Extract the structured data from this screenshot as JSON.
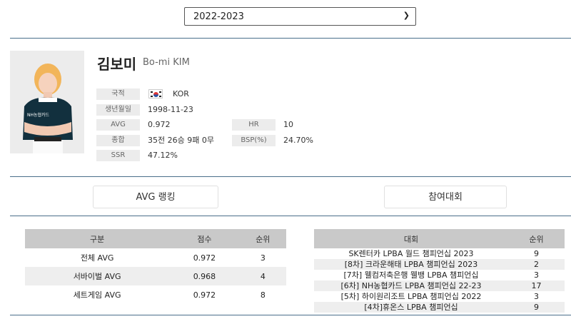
{
  "season": {
    "selected": "2022-2023"
  },
  "player": {
    "name_ko": "김보미",
    "name_en": "Bo-mi KIM",
    "info": {
      "nationality_label": "국적",
      "nationality": "KOR",
      "birth_label": "생년월일",
      "birth": "1998-11-23",
      "avg_label": "AVG",
      "avg": "0.972",
      "hr_label": "HR",
      "hr": "10",
      "total_label": "종합",
      "total": "35전 26승 9패 0무",
      "bsp_label": "BSP(%)",
      "bsp": "24.70%",
      "ssr_label": "SSR",
      "ssr": "47.12%"
    }
  },
  "buttons": {
    "avg_ranking": "AVG 랭킹",
    "tournaments": "참여대회"
  },
  "ranking_table": {
    "headers": [
      "구분",
      "점수",
      "순위"
    ],
    "rows": [
      [
        "전체 AVG",
        "0.972",
        "3"
      ],
      [
        "서바이벌 AVG",
        "0.968",
        "4"
      ],
      [
        "세트게임 AVG",
        "0.972",
        "8"
      ]
    ]
  },
  "tournament_table": {
    "headers": [
      "대회",
      "순위"
    ],
    "rows": [
      [
        "SK렌터카 LPBA 월드 챔피언십 2023",
        "9"
      ],
      [
        "[8차] 크라운해태 LPBA 챔피언십 2023",
        "2"
      ],
      [
        "[7차] 웰컴저축은행 웰뱅 LPBA 챔피언십",
        "3"
      ],
      [
        "[6차] NH농협카드 LPBA 챔피언십 22-23",
        "17"
      ],
      [
        "[5차] 하이원리조트 LPBA 챔피언십 2022",
        "3"
      ],
      [
        "[4차]휴온스 LPBA 챔피언십",
        "9"
      ]
    ]
  }
}
